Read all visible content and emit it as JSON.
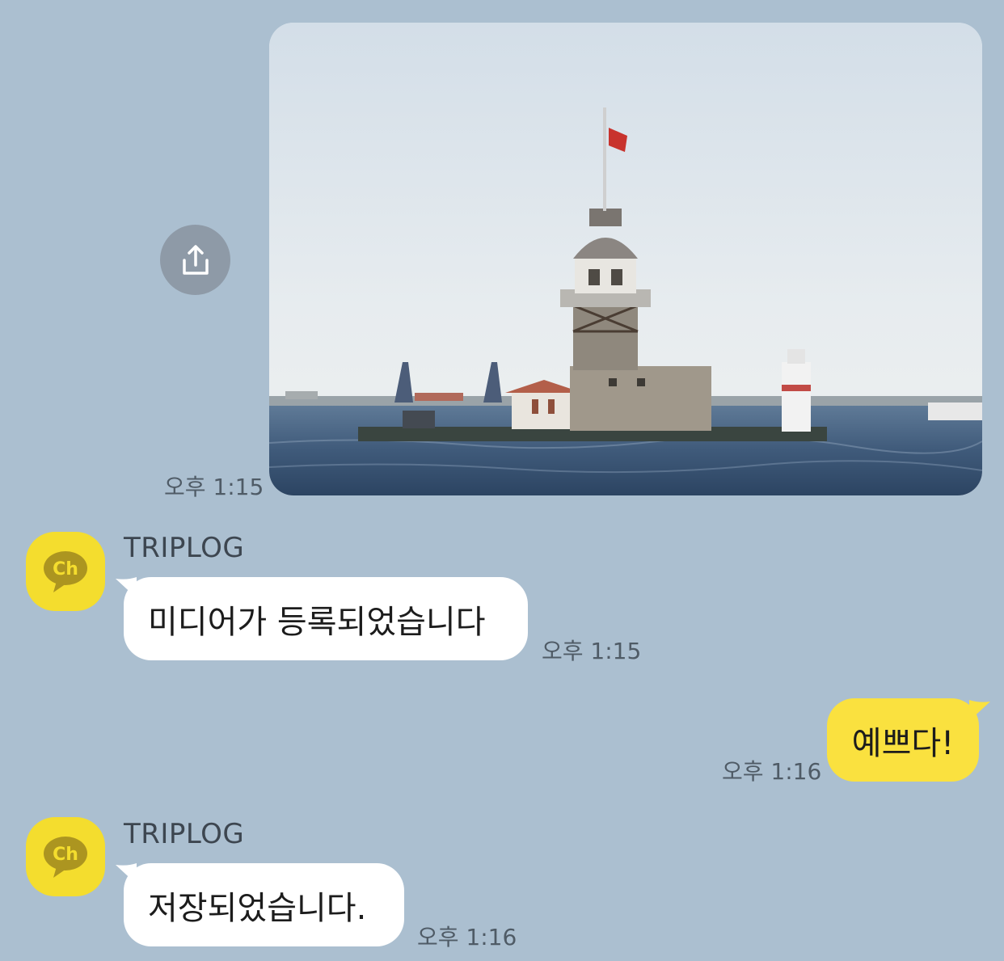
{
  "messages": [
    {
      "type": "image",
      "time": "오후 1:15"
    },
    {
      "type": "received",
      "sender": "TRIPLOG",
      "avatar_label": "Ch",
      "text": "미디어가 등록되었습니다",
      "time": "오후 1:15"
    },
    {
      "type": "sent",
      "text": "예쁘다!",
      "time": "오후 1:16"
    },
    {
      "type": "received",
      "sender": "TRIPLOG",
      "avatar_label": "Ch",
      "text": "저장되었습니다.",
      "time": "오후 1:16"
    }
  ],
  "icons": {
    "share": "share-icon",
    "avatar": "kakao-channel-icon"
  },
  "colors": {
    "background": "#abbfd0",
    "sent_bubble": "#fae13f",
    "received_bubble": "#ffffff",
    "avatar": "#f4dd2e"
  }
}
